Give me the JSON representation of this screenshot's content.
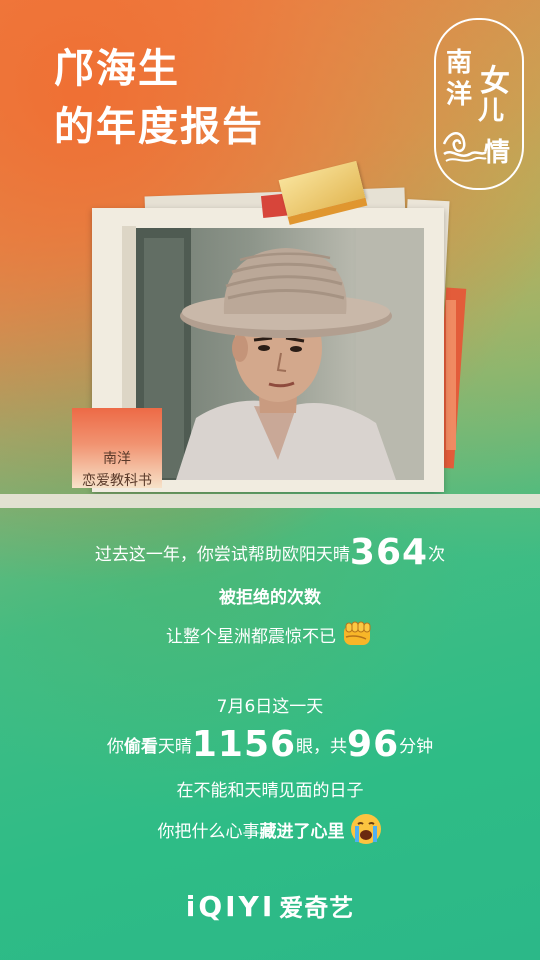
{
  "title": {
    "line1": "邝海生",
    "line2": "的年度报告"
  },
  "show_logo": {
    "chars": [
      "南",
      "洋",
      "女",
      "儿",
      "情"
    ]
  },
  "label_card": {
    "line1": "南洋",
    "line2": "恋爱教科书"
  },
  "stats": {
    "line1_prefix": "过去这一年，你尝试帮助欧阳天晴",
    "line1_number": "364",
    "line1_suffix": "次",
    "line2": "被拒绝的次数",
    "line3": "让整个星洲都震惊不已",
    "line3_emoji": "fist-emoji",
    "line4": "7月6日这一天",
    "line5_prefix": "你",
    "line5_bold": "偷看",
    "line5_mid": "天晴",
    "line5_number1": "1156",
    "line5_mid2": "眼，共",
    "line5_number2": "96",
    "line5_suffix": "分钟",
    "line6": "在不能和天晴见面的日子",
    "line7_prefix": "你把什么心事",
    "line7_bold": "藏进了心里",
    "line7_emoji": "crying-face-emoji"
  },
  "footer": {
    "brand_latin": "iQIYI",
    "brand_cn": "爱奇艺"
  },
  "colors": {
    "orange": "#ee7f44",
    "green": "#2ebc86",
    "text": "#ffffff"
  }
}
